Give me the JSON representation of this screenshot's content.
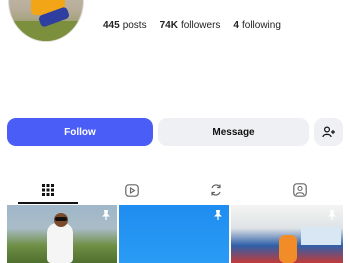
{
  "profile": {
    "posts_count": "445",
    "posts_label": "posts",
    "followers_count": "74K",
    "followers_label": "followers",
    "following_count": "4",
    "following_label": "following"
  },
  "actions": {
    "follow_label": "Follow",
    "message_label": "Message",
    "follow_color": "#4a5df7"
  },
  "tabs": [
    {
      "icon": "grid-icon",
      "active": true
    },
    {
      "icon": "reels-icon",
      "active": false
    },
    {
      "icon": "reposts-icon",
      "active": false
    },
    {
      "icon": "tagged-icon",
      "active": false
    }
  ],
  "posts": [
    {
      "pinned": true
    },
    {
      "pinned": true
    },
    {
      "pinned": true
    }
  ]
}
